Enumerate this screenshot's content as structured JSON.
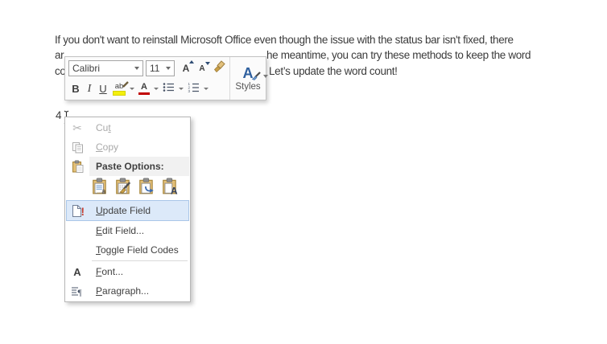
{
  "document": {
    "line1": "If you don't want to reinstall Microsoft Office even though the issue with the status bar isn't fixed, there",
    "line2_left": "ar",
    "line2_right": "he meantime, you can try these methods to keep the word",
    "line3_left": "co",
    "line3_right": "Let’s update the word count!",
    "field_value": "4"
  },
  "mini_toolbar": {
    "font_name": "Calibri",
    "font_size": "11",
    "bold": "B",
    "italic": "I",
    "underline": "U",
    "highlight_letters": "ab",
    "font_color_letter": "A",
    "grow_font_letter": "A",
    "shrink_font_letter": "A",
    "styles_icon_letter": "A",
    "styles_label": "Styles"
  },
  "context_menu": {
    "items": [
      {
        "id": "cut",
        "pre": "Cu",
        "key": "t",
        "post": "",
        "disabled": true
      },
      {
        "id": "copy",
        "pre": "",
        "key": "C",
        "post": "opy",
        "disabled": true
      },
      {
        "id": "paste_options",
        "label": "Paste Options:"
      },
      {
        "id": "update_field",
        "pre": "",
        "key": "U",
        "post": "pdate Field",
        "highlighted": true
      },
      {
        "id": "edit_field",
        "pre": "",
        "key": "E",
        "post": "dit Field..."
      },
      {
        "id": "toggle_field_codes",
        "pre": "",
        "key": "T",
        "post": "oggle Field Codes"
      },
      {
        "id": "font",
        "pre": "",
        "key": "F",
        "post": "ont..."
      },
      {
        "id": "paragraph",
        "pre": "",
        "key": "P",
        "post": "aragraph..."
      }
    ],
    "paste_option_icons": [
      "keep-source-formatting",
      "merge-formatting",
      "paste-link",
      "keep-text-only"
    ],
    "font_icon_letter": "A"
  },
  "colors": {
    "menu_highlight_bg": "#dce9f9",
    "menu_highlight_border": "#a9c6e8",
    "clipboard_tan": "#e3bf77",
    "exclamation_red": "#c43a2d",
    "styles_blue": "#2e5f9e",
    "font_color_red": "#c00000",
    "highlight_yellow": "#f3ef0c",
    "disabled_gray": "#a9a9a9",
    "text_gray": "#3b3b3b"
  }
}
